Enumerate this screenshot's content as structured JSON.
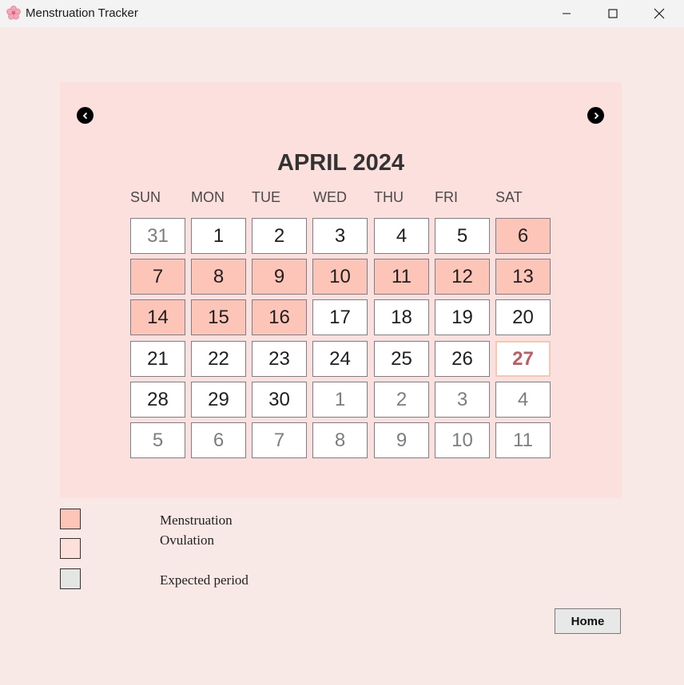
{
  "window": {
    "title": "Menstruation Tracker"
  },
  "calendar": {
    "month_label": "APRIL 2024",
    "weekdays": [
      "SUN",
      "MON",
      "TUE",
      "WED",
      "THU",
      "FRI",
      "SAT"
    ],
    "weeks": [
      [
        {
          "day": "31",
          "type": "other"
        },
        {
          "day": "1",
          "type": "normal"
        },
        {
          "day": "2",
          "type": "normal"
        },
        {
          "day": "3",
          "type": "normal"
        },
        {
          "day": "4",
          "type": "normal"
        },
        {
          "day": "5",
          "type": "normal"
        },
        {
          "day": "6",
          "type": "menstruation"
        }
      ],
      [
        {
          "day": "7",
          "type": "menstruation"
        },
        {
          "day": "8",
          "type": "menstruation"
        },
        {
          "day": "9",
          "type": "menstruation"
        },
        {
          "day": "10",
          "type": "menstruation"
        },
        {
          "day": "11",
          "type": "menstruation"
        },
        {
          "day": "12",
          "type": "menstruation"
        },
        {
          "day": "13",
          "type": "menstruation"
        }
      ],
      [
        {
          "day": "14",
          "type": "menstruation"
        },
        {
          "day": "15",
          "type": "menstruation"
        },
        {
          "day": "16",
          "type": "menstruation"
        },
        {
          "day": "17",
          "type": "normal"
        },
        {
          "day": "18",
          "type": "normal"
        },
        {
          "day": "19",
          "type": "normal"
        },
        {
          "day": "20",
          "type": "normal"
        }
      ],
      [
        {
          "day": "21",
          "type": "normal"
        },
        {
          "day": "22",
          "type": "normal"
        },
        {
          "day": "23",
          "type": "normal"
        },
        {
          "day": "24",
          "type": "normal"
        },
        {
          "day": "25",
          "type": "normal"
        },
        {
          "day": "26",
          "type": "normal"
        },
        {
          "day": "27",
          "type": "today"
        }
      ],
      [
        {
          "day": "28",
          "type": "normal"
        },
        {
          "day": "29",
          "type": "normal"
        },
        {
          "day": "30",
          "type": "normal"
        },
        {
          "day": "1",
          "type": "other"
        },
        {
          "day": "2",
          "type": "other"
        },
        {
          "day": "3",
          "type": "other"
        },
        {
          "day": "4",
          "type": "other"
        }
      ],
      [
        {
          "day": "5",
          "type": "other"
        },
        {
          "day": "6",
          "type": "other"
        },
        {
          "day": "7",
          "type": "other"
        },
        {
          "day": "8",
          "type": "other"
        },
        {
          "day": "9",
          "type": "other"
        },
        {
          "day": "10",
          "type": "other"
        },
        {
          "day": "11",
          "type": "other"
        }
      ]
    ],
    "prev_icon": "chevron-left-icon",
    "next_icon": "chevron-right-icon"
  },
  "legend": [
    {
      "label": "Menstruation",
      "color": "#fdc4b8"
    },
    {
      "label": "Ovulation",
      "color": "#fde0d9"
    },
    {
      "label": "Expected period",
      "color": "#e4e6e3"
    }
  ],
  "home_button": {
    "label": "Home"
  },
  "colors": {
    "background": "#f8e8e6",
    "panel": "#fbe0dd",
    "menstruation": "#fdc4b8",
    "today_text": "#c05a64"
  }
}
